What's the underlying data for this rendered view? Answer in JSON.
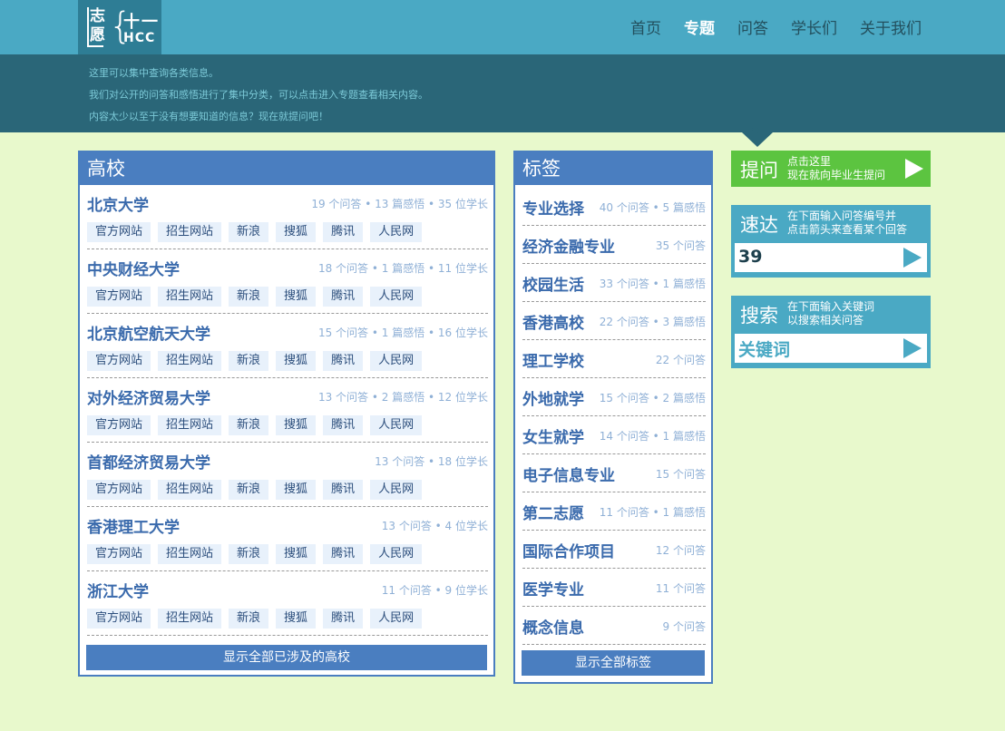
{
  "header": {
    "logo": {
      "zhi": "志",
      "yuan": "愿",
      "num": "十一",
      "hcc": "HCC",
      "brace": "{"
    },
    "nav": [
      {
        "label": "首页",
        "active": false
      },
      {
        "label": "专题",
        "active": true
      },
      {
        "label": "问答",
        "active": false
      },
      {
        "label": "学长们",
        "active": false
      },
      {
        "label": "关于我们",
        "active": false
      }
    ],
    "intro": [
      "这里可以集中查询各类信息。",
      "我们对公开的问答和感悟进行了集中分类，可以点击进入专题查看相关内容。",
      "内容太少以至于没有想要知道的信息？现在就提问吧！"
    ]
  },
  "universities": {
    "title": "高校",
    "link_labels": [
      "官方网站",
      "招生网站",
      "新浪",
      "搜狐",
      "腾讯",
      "人民网"
    ],
    "items": [
      {
        "name": "北京大学",
        "stats": "19 个问答 • 13 篇感悟 • 35 位学长"
      },
      {
        "name": "中央财经大学",
        "stats": "18 个问答 • 1 篇感悟 • 11 位学长"
      },
      {
        "name": "北京航空航天大学",
        "stats": "15 个问答 • 1 篇感悟 • 16 位学长"
      },
      {
        "name": "对外经济贸易大学",
        "stats": "13 个问答 • 2 篇感悟 • 12 位学长"
      },
      {
        "name": "首都经济贸易大学",
        "stats": "13 个问答 • 18 位学长"
      },
      {
        "name": "香港理工大学",
        "stats": "13 个问答 • 4 位学长"
      },
      {
        "name": "浙江大学",
        "stats": "11 个问答 • 9 位学长"
      }
    ],
    "show_all": "显示全部已涉及的高校"
  },
  "tags": {
    "title": "标签",
    "items": [
      {
        "name": "专业选择",
        "stats": "40 个问答 • 5 篇感悟"
      },
      {
        "name": "经济金融专业",
        "stats": "35 个问答"
      },
      {
        "name": "校园生活",
        "stats": "33 个问答 • 1 篇感悟"
      },
      {
        "name": "香港高校",
        "stats": "22 个问答 • 3 篇感悟"
      },
      {
        "name": "理工学校",
        "stats": "22 个问答"
      },
      {
        "name": "外地就学",
        "stats": "15 个问答 • 2 篇感悟"
      },
      {
        "name": "女生就学",
        "stats": "14 个问答 • 1 篇感悟"
      },
      {
        "name": "电子信息专业",
        "stats": "15 个问答"
      },
      {
        "name": "第二志愿",
        "stats": "11 个问答 • 1 篇感悟"
      },
      {
        "name": "国际合作项目",
        "stats": "12 个问答"
      },
      {
        "name": "医学专业",
        "stats": "11 个问答"
      },
      {
        "name": "概念信息",
        "stats": "9 个问答"
      }
    ],
    "show_all": "显示全部标签"
  },
  "sidebar": {
    "ask": {
      "qmark": "?",
      "label": "提问",
      "desc1": "点击这里",
      "desc2": "现在就向毕业生提问",
      "color": "#5cc440"
    },
    "quick": {
      "label": "速达",
      "desc1": "在下面输入问答编号并",
      "desc2": "点击箭头来查看某个回答",
      "value": "39",
      "color": "#4aa9c4"
    },
    "search": {
      "label": "搜索",
      "desc1": "在下面输入关键词",
      "desc2": "以搜索相关问答",
      "placeholder": "关键词",
      "color": "#4aa9c4"
    }
  },
  "colors": {
    "page_bg": "#e8f9cc",
    "header": "#4aa9c4",
    "subheader": "#2a6678",
    "panel_blue": "#4a7ec0"
  }
}
